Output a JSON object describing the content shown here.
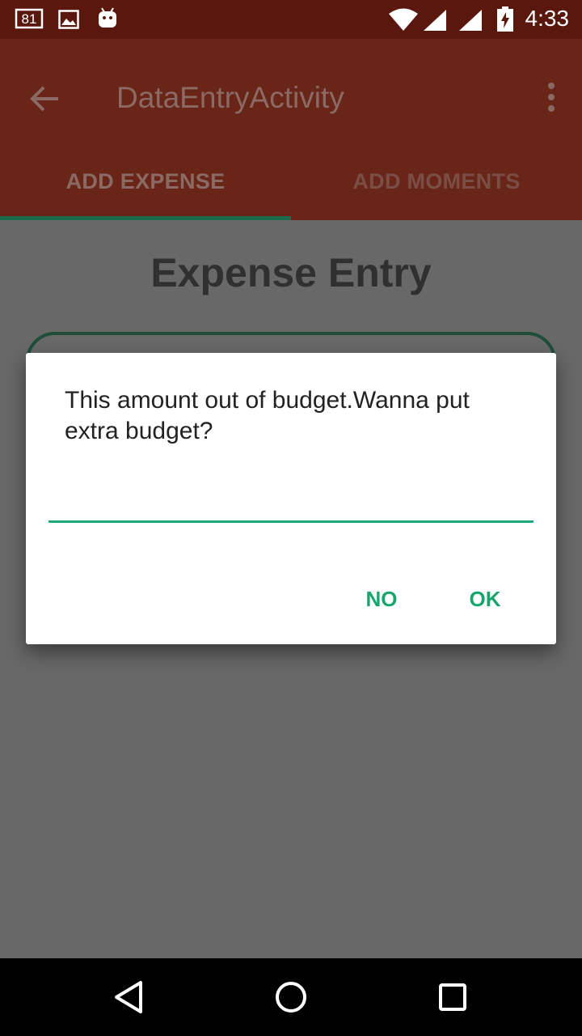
{
  "status_bar": {
    "notification_badge": "81",
    "time": "4:33",
    "icons": [
      "notification-count-icon",
      "image-icon",
      "android-icon",
      "wifi-icon",
      "signal-icon",
      "signal-icon-2",
      "battery-charging-icon"
    ]
  },
  "app_bar": {
    "title": "DataEntryActivity",
    "back_icon": "arrow-back-icon",
    "overflow_icon": "more-vert-icon"
  },
  "tabs": [
    {
      "label": "ADD EXPENSE",
      "selected": true
    },
    {
      "label": "ADD MOMENTS",
      "selected": false
    }
  ],
  "content": {
    "title": "Expense Entry"
  },
  "dialog": {
    "message": "This amount out of budget.Wanna put extra budget?",
    "input_value": "",
    "no_label": "NO",
    "ok_label": "OK"
  },
  "colors": {
    "status_bar": "#5a170d",
    "app_bar": "#692518",
    "tab_indicator": "#1b6b4c",
    "accent": "#1aa56f",
    "scrim_background": "#686868"
  },
  "nav_bar": {
    "icons": [
      "back-triangle-icon",
      "home-circle-icon",
      "recents-square-icon"
    ]
  }
}
